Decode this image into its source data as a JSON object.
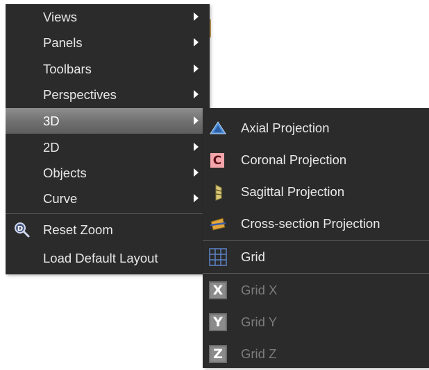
{
  "main_menu": {
    "items": [
      {
        "label": "Views",
        "has_submenu": true
      },
      {
        "label": "Panels",
        "has_submenu": true
      },
      {
        "label": "Toolbars",
        "has_submenu": true
      },
      {
        "label": "Perspectives",
        "has_submenu": true
      },
      {
        "label": "3D",
        "has_submenu": true,
        "highlighted": true
      },
      {
        "label": "2D",
        "has_submenu": true
      },
      {
        "label": "Objects",
        "has_submenu": true
      },
      {
        "label": "Curve",
        "has_submenu": true
      }
    ],
    "actions": [
      {
        "label": "Reset Zoom",
        "icon": "zoom-reset-icon"
      },
      {
        "label": "Load Default Layout"
      }
    ]
  },
  "submenu_3d": {
    "projections": [
      {
        "label": "Axial Projection",
        "icon": "axial-projection-icon"
      },
      {
        "label": "Coronal Projection",
        "icon": "coronal-projection-icon",
        "icon_letter": "C"
      },
      {
        "label": "Sagittal Projection",
        "icon": "sagittal-projection-icon"
      },
      {
        "label": "Cross-section Projection",
        "icon": "cross-section-projection-icon"
      }
    ],
    "grid": {
      "label": "Grid",
      "icon": "grid-icon"
    },
    "grid_axes": [
      {
        "label": "Grid X",
        "icon_letter": "X",
        "enabled": false
      },
      {
        "label": "Grid Y",
        "icon_letter": "Y",
        "enabled": false
      },
      {
        "label": "Grid Z",
        "icon_letter": "Z",
        "enabled": false
      }
    ]
  },
  "colors": {
    "menu_bg": "#2b2b2b",
    "highlight": "#7a7a7a",
    "text": "#e8e8e8",
    "disabled_text": "#7c7c7c"
  }
}
